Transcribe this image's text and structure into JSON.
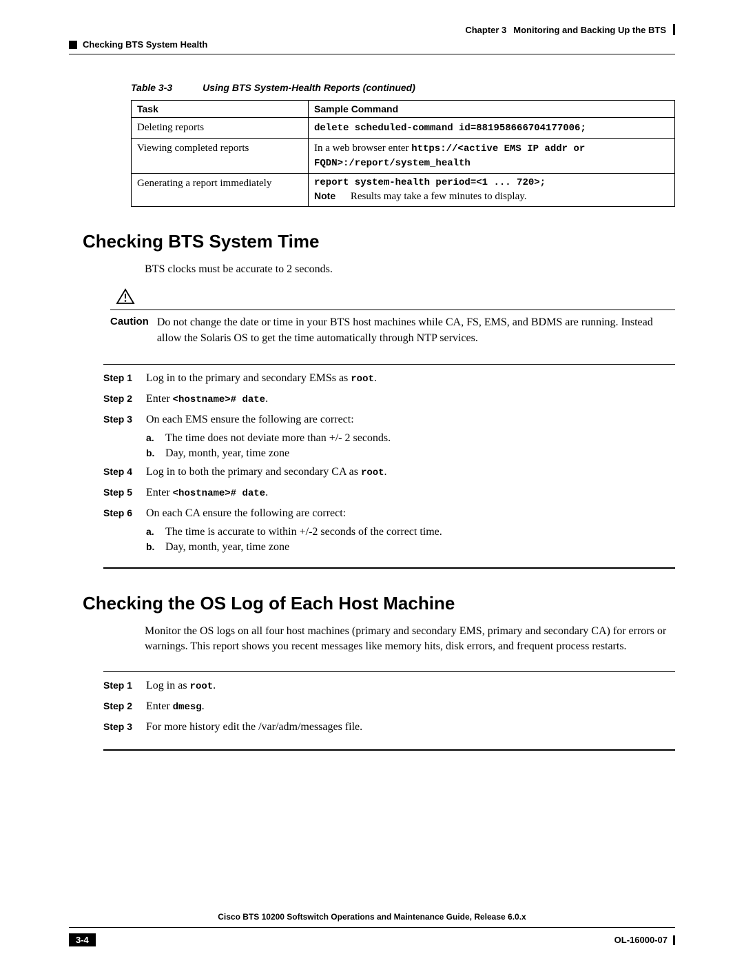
{
  "header": {
    "chapter_label": "Chapter 3",
    "chapter_title": "Monitoring and Backing Up the BTS",
    "section_crumb": "Checking BTS System Health"
  },
  "table": {
    "label": "Table 3-3",
    "title": "Using BTS System-Health Reports (continued)",
    "headers": {
      "task": "Task",
      "cmd": "Sample Command"
    },
    "rows": [
      {
        "task": "Deleting reports",
        "cmd_mono": "delete scheduled-command id=881958666704177006;"
      },
      {
        "task": "Viewing completed reports",
        "cmd_pre": "In a web browser enter ",
        "cmd_mono": "https://<active EMS IP addr or FQDN>:/report/system_health"
      },
      {
        "task": "Generating a report immediately",
        "cmd_mono": "report system-health period=<1 ... 720>;",
        "note_label": "Note",
        "note_text": "Results may take a few minutes to display."
      }
    ]
  },
  "section1": {
    "title": "Checking BTS System Time",
    "intro": "BTS clocks must be accurate to 2 seconds.",
    "caution_label": "Caution",
    "caution_text": "Do not change the date or time in your BTS host machines while CA, FS, EMS, and BDMS are running. Instead allow the Solaris OS to get the time automatically through NTP services.",
    "steps": [
      {
        "label": "Step 1",
        "text_pre": "Log in to the primary and secondary EMSs as ",
        "mono": "root",
        "text_post": "."
      },
      {
        "label": "Step 2",
        "text_pre": "Enter ",
        "mono": "<hostname># date",
        "text_post": "."
      },
      {
        "label": "Step 3",
        "text_pre": "On each EMS ensure the following are correct:",
        "subs": [
          {
            "letter": "a.",
            "text": "The time does not deviate more than +/- 2 seconds."
          },
          {
            "letter": "b.",
            "text": "Day, month, year, time zone"
          }
        ]
      },
      {
        "label": "Step 4",
        "text_pre": "Log in to both the primary and secondary CA as ",
        "mono": "root",
        "text_post": "."
      },
      {
        "label": "Step 5",
        "text_pre": "Enter ",
        "mono": "<hostname># date",
        "text_post": "."
      },
      {
        "label": "Step 6",
        "text_pre": "On each CA ensure the following are correct:",
        "subs": [
          {
            "letter": "a.",
            "text": "The time is accurate to within +/-2 seconds of the correct time."
          },
          {
            "letter": "b.",
            "text": "Day, month, year, time zone"
          }
        ]
      }
    ]
  },
  "section2": {
    "title": "Checking the OS Log of Each Host Machine",
    "intro": "Monitor the OS logs on all four host machines (primary and secondary EMS, primary and secondary CA) for errors or warnings. This report shows you recent messages like memory hits, disk errors, and frequent process restarts.",
    "steps": [
      {
        "label": "Step 1",
        "text_pre": "Log in as ",
        "mono": "root",
        "text_post": "."
      },
      {
        "label": "Step 2",
        "text_pre": "Enter ",
        "mono": "dmesg",
        "text_post": "."
      },
      {
        "label": "Step 3",
        "text_pre": "For more history edit the /var/adm/messages file."
      }
    ]
  },
  "footer": {
    "doc_title": "Cisco BTS 10200 Softswitch Operations and Maintenance Guide, Release 6.0.x",
    "page_number": "3-4",
    "doc_id": "OL-16000-07"
  }
}
